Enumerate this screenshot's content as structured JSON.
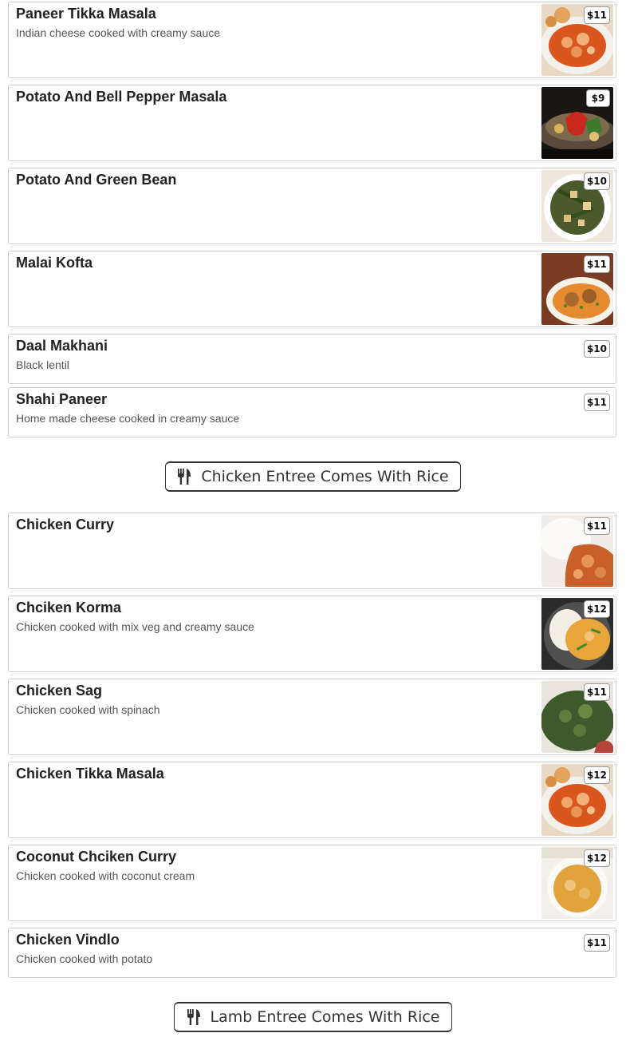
{
  "veg_items": [
    {
      "name": "Paneer Tikka Masala",
      "desc": "Indian cheese cooked with creamy sauce",
      "price": "$11",
      "image": "paneer-tikka-masala-photo"
    },
    {
      "name": "Potato And Bell Pepper Masala",
      "desc": "",
      "price": "$9",
      "image": "potato-bell-pepper-photo"
    },
    {
      "name": "Potato And Green Bean",
      "desc": "",
      "price": "$10",
      "image": "potato-green-bean-photo"
    },
    {
      "name": "Malai Kofta",
      "desc": "",
      "price": "$11",
      "image": "malai-kofta-photo"
    },
    {
      "name": "Daal Makhani",
      "desc": "Black lentil",
      "price": "$10"
    },
    {
      "name": "Shahi Paneer",
      "desc": "Home made cheese cooked in creamy sauce",
      "price": "$11"
    }
  ],
  "chicken_section": {
    "title": "Chicken Entree Comes With Rice",
    "icon": "utensils-icon"
  },
  "chicken_items": [
    {
      "name": "Chicken Curry",
      "desc": "",
      "price": "$11",
      "image": "chicken-curry-photo"
    },
    {
      "name": "Chciken Korma",
      "desc": "Chicken cooked with mix veg and creamy sauce",
      "price": "$12",
      "image": "chicken-korma-photo"
    },
    {
      "name": "Chicken Sag",
      "desc": "Chicken cooked with spinach",
      "price": "$11",
      "image": "chicken-sag-photo"
    },
    {
      "name": "Chicken Tikka Masala",
      "desc": "",
      "price": "$12",
      "image": "chicken-tikka-masala-photo"
    },
    {
      "name": "Coconut Chciken Curry",
      "desc": "Chicken cooked with coconut cream",
      "price": "$12",
      "image": "coconut-chicken-curry-photo"
    },
    {
      "name": "Chicken Vindlo",
      "desc": "Chicken cooked with potato",
      "price": "$11"
    }
  ],
  "lamb_section": {
    "title": "Lamb Entree Comes With Rice",
    "icon": "utensils-icon"
  }
}
